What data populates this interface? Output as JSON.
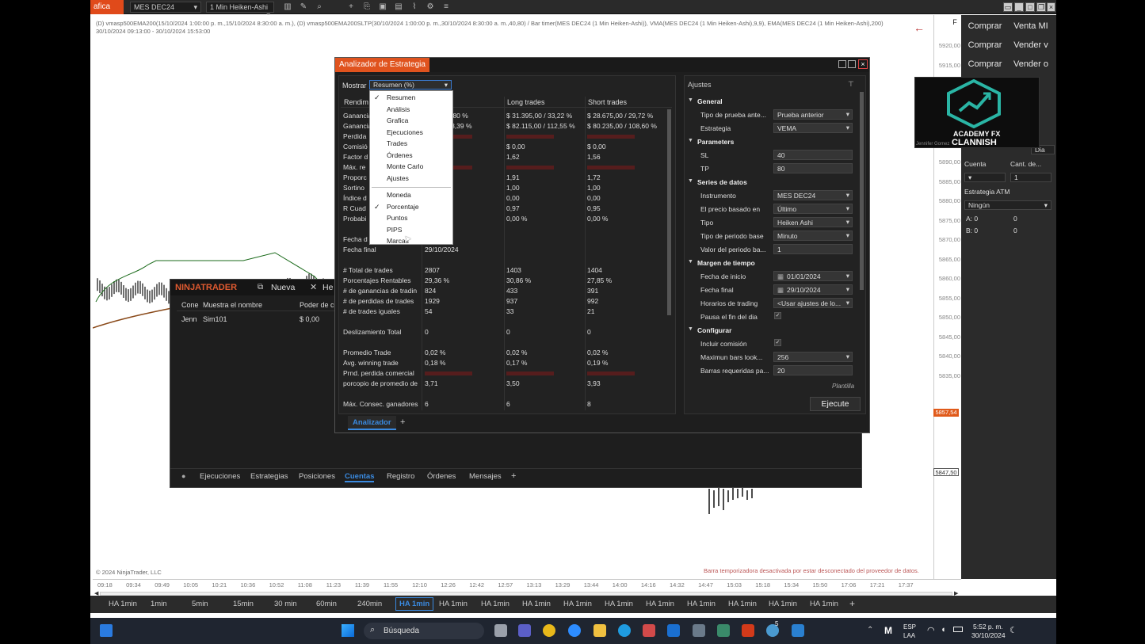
{
  "toolbar": {
    "app_tab": "afica",
    "instrument": "MES DEC24",
    "interval": "1 Min Heiken-Ashi"
  },
  "chart": {
    "info_line1": "(D) vmasp500EMA200(15/10/2024 1:00:00 p. m.,15/10/2024 8:30:00 a. m.), (D) vmasp500EMA200SLTP(30/10/2024 1:00:00 p. m.,30/10/2024 8:30:00 a. m.,40,80) / Bar timer(MES DEC24 (1 Min Heiken-Ashi)), VMA(MES DEC24 (1 Min Heiken-Ashi),9,9), EMA(MES DEC24 (1 Min Heiken-Ashi),200)",
    "info_line2": "30/10/2024 09:13:00 - 30/10/2024 15:53:00",
    "copyright": "© 2024 NinjaTrader, LLC",
    "disconnected_msg": "Barra temporizadora desactivada por estar desconectado del proveedor de datos.",
    "price_ticks": [
      "5920,00",
      "5915,00",
      "5910,00",
      "5905,00",
      "5900,00",
      "5895,00",
      "5890,00",
      "5885,00",
      "5880,00",
      "5875,00",
      "5870,00",
      "5865,00",
      "5860,00",
      "5855,00",
      "5850,00",
      "5845,00",
      "5840,00",
      "5835,00"
    ],
    "price_badge1": "5857,54",
    "price_badge2": "5847,50",
    "time_ticks": [
      "09:18",
      "09:34",
      "09:49",
      "10:05",
      "10:21",
      "10:36",
      "10:52",
      "11:08",
      "11:23",
      "11:39",
      "11:55",
      "12:10",
      "12:26",
      "12:42",
      "12:57",
      "13:13",
      "13:29",
      "13:44",
      "14:00",
      "14:16",
      "14:32",
      "14:47",
      "15:03",
      "15:18",
      "15:34",
      "15:50",
      "17:06",
      "17:21",
      "17:37"
    ]
  },
  "right_panel": {
    "buy1": "Comprar",
    "sell_mkt": "Venta MI",
    "buy2": "Comprar",
    "sell2": "Vender v",
    "buy3": "Comprar",
    "sell3": "Vender o",
    "tif": "Dia",
    "account_label": "Cuenta",
    "qty_label": "Cant. de...",
    "qty_value": "1",
    "atm_label": "Estrategia ATM",
    "atm_value": "Ningún",
    "a_label": "A:",
    "a_val1": "0",
    "a_val2": "0",
    "b_label": "B:",
    "b_val1": "0",
    "b_val2": "0",
    "logo_line1": "ACADEMY FX",
    "logo_line2": "CLANNISH",
    "webcam_name": "Jennifer Gomez"
  },
  "bottom_tabs": [
    "HA 1min",
    "1min",
    "5min",
    "15min",
    "30 min",
    "60min",
    "240min",
    "HA 1min",
    "HA 1min",
    "HA 1min",
    "HA 1min",
    "HA 1min",
    "HA 1min",
    "HA 1min",
    "HA 1min",
    "HA 1min",
    "HA 1min",
    "HA 1min"
  ],
  "bottom_tab_active": 7,
  "taskbar": {
    "search": "Búsqueda",
    "lang1": "ESP",
    "lang2": "LAA",
    "time": "5:52 p. m.",
    "date": "30/10/2024",
    "badge": "5"
  },
  "ninjatrader": {
    "brand": "NINJATRADER",
    "new_menu": "Nueva",
    "tools_menu": "He",
    "col_conn": "Cone",
    "col_name": "Muestra el nombre",
    "col_power": "Poder de co",
    "row_conn": "Jenn",
    "row_name": "Sim101",
    "row_power": "$ 0,00",
    "tabs": [
      "Ejecuciones",
      "Estrategias",
      "Posiciones",
      "Cuentas",
      "Registro",
      "Órdenes",
      "Mensajes"
    ],
    "active_tab": 3
  },
  "analyzer": {
    "title": "Analizador de Estrategia",
    "show_label": "Mostrar",
    "show_value": "Resumen (%)",
    "col_perf": "Rendim",
    "col_all": "s",
    "col_long": "Long trades",
    "col_short": "Short trades",
    "tab": "Analizador",
    "add_tab": "+",
    "dropdown": {
      "items": [
        "Resumen",
        "Análisis",
        "Grafica",
        "Ejecuciones",
        "Trades",
        "Órdenes",
        "Monte Carlo",
        "Ajustes"
      ],
      "units": [
        "Moneda",
        "Porcentaje",
        "Puntos",
        "PIPS",
        "Marcas"
      ],
      "checked_item": "Resumen",
      "checked_unit": "Porcentaje"
    },
    "metrics": [
      {
        "label": "Ganancia",
        "all": "0,00 / 72,80 %",
        "long": "$ 31.395,00 / 33,22 %",
        "short": "$ 28.675,00 / 29,72 %"
      },
      {
        "label": "Ganancia",
        "all": "0,00 / 343,39 %",
        "long": "$ 82.115,00 / 112,55 %",
        "short": "$ 80.235,00 / 108,60 %"
      },
      {
        "label": "Perdida",
        "all": "",
        "long": "",
        "short": "",
        "red": true
      },
      {
        "label": "Comisió",
        "all": "",
        "long": "$ 0,00",
        "short": "$ 0,00"
      },
      {
        "label": "Factor d",
        "all": "",
        "long": "1,62",
        "short": "1,56"
      },
      {
        "label": "Máx. re",
        "all": "",
        "long": "",
        "short": "",
        "red": true
      },
      {
        "label": "Proporc",
        "all": "",
        "long": "1,91",
        "short": "1,72"
      },
      {
        "label": "Sortino",
        "all": "",
        "long": "1,00",
        "short": "1,00"
      },
      {
        "label": "Índice d",
        "all": "",
        "long": "0,00",
        "short": "0,00"
      },
      {
        "label": "R Cuad",
        "all": "",
        "long": "0,97",
        "short": "0,95"
      },
      {
        "label": "Probabi",
        "all": "",
        "long": "0,00 %",
        "short": "0,00 %"
      },
      {
        "label": "",
        "all": "",
        "long": "",
        "short": ""
      },
      {
        "label": "Fecha d",
        "all": "24",
        "long": "",
        "short": ""
      },
      {
        "label": "Fecha final",
        "all": "29/10/2024",
        "long": "",
        "short": ""
      },
      {
        "label": "",
        "all": "",
        "long": "",
        "short": ""
      },
      {
        "label": "# Total de trades",
        "all": "2807",
        "long": "1403",
        "short": "1404"
      },
      {
        "label": "Porcentajes Rentables",
        "all": "29,36 %",
        "long": "30,86 %",
        "short": "27,85 %"
      },
      {
        "label": "# de ganancias de tradin",
        "all": "824",
        "long": "433",
        "short": "391"
      },
      {
        "label": "# de perdidas de trades",
        "all": "1929",
        "long": "937",
        "short": "992"
      },
      {
        "label": "# de trades iguales",
        "all": "54",
        "long": "33",
        "short": "21"
      },
      {
        "label": "",
        "all": "",
        "long": "",
        "short": ""
      },
      {
        "label": "Deslizamiento Total",
        "all": "0",
        "long": "0",
        "short": "0"
      },
      {
        "label": "",
        "all": "",
        "long": "",
        "short": ""
      },
      {
        "label": "Promedio Trade",
        "all": "0,02 %",
        "long": "0,02 %",
        "short": "0,02 %"
      },
      {
        "label": "Avg. winning trade",
        "all": "0,18 %",
        "long": "0,17 %",
        "short": "0,19 %"
      },
      {
        "label": "Prnd. perdida comercial",
        "all": "",
        "long": "",
        "short": "",
        "red": true
      },
      {
        "label": "porcopio de promedio de",
        "all": "3,71",
        "long": "3,50",
        "short": "3,93"
      },
      {
        "label": "",
        "all": "",
        "long": "",
        "short": ""
      },
      {
        "label": "Máx. Consec. ganadores",
        "all": "6",
        "long": "6",
        "short": "8"
      }
    ],
    "settings": {
      "title": "Ajustes",
      "template": "Plantilla",
      "run_button": "Ejecute",
      "sections": [
        {
          "name": "General",
          "rows": [
            {
              "label": "Tipo de prueba ante...",
              "value": "Prueba anterior",
              "kind": "select"
            },
            {
              "label": "Estrategia",
              "value": "VEMA",
              "kind": "select"
            }
          ]
        },
        {
          "name": "Parameters",
          "rows": [
            {
              "label": "SL",
              "value": "40",
              "kind": "input"
            },
            {
              "label": "TP",
              "value": "80",
              "kind": "input"
            }
          ]
        },
        {
          "name": "Series de datos",
          "rows": [
            {
              "label": "Instrumento",
              "value": "MES DEC24",
              "kind": "select"
            },
            {
              "label": "El precio basado en",
              "value": "Último",
              "kind": "select"
            },
            {
              "label": "Tipo",
              "value": "Heiken Ashi",
              "kind": "select"
            },
            {
              "label": "Tipo de periodo base",
              "value": "Minuto",
              "kind": "select"
            },
            {
              "label": "Valor del periodo ba...",
              "value": "1",
              "kind": "input"
            }
          ]
        },
        {
          "name": "Margen de tiempo",
          "rows": [
            {
              "label": "Fecha de inicio",
              "value": "01/01/2024",
              "kind": "date"
            },
            {
              "label": "Fecha final",
              "value": "29/10/2024",
              "kind": "date"
            },
            {
              "label": "Horarios de trading",
              "value": "<Usar ajustes de lo...",
              "kind": "select"
            },
            {
              "label": "Pausa el fin del dia",
              "value": "",
              "kind": "check"
            }
          ]
        },
        {
          "name": "Configurar",
          "rows": [
            {
              "label": "Incluir comisión",
              "value": "",
              "kind": "check"
            },
            {
              "label": "Maximun bars look...",
              "value": "256",
              "kind": "select"
            },
            {
              "label": "Barras requeridas pa...",
              "value": "20",
              "kind": "input"
            }
          ]
        }
      ]
    }
  }
}
